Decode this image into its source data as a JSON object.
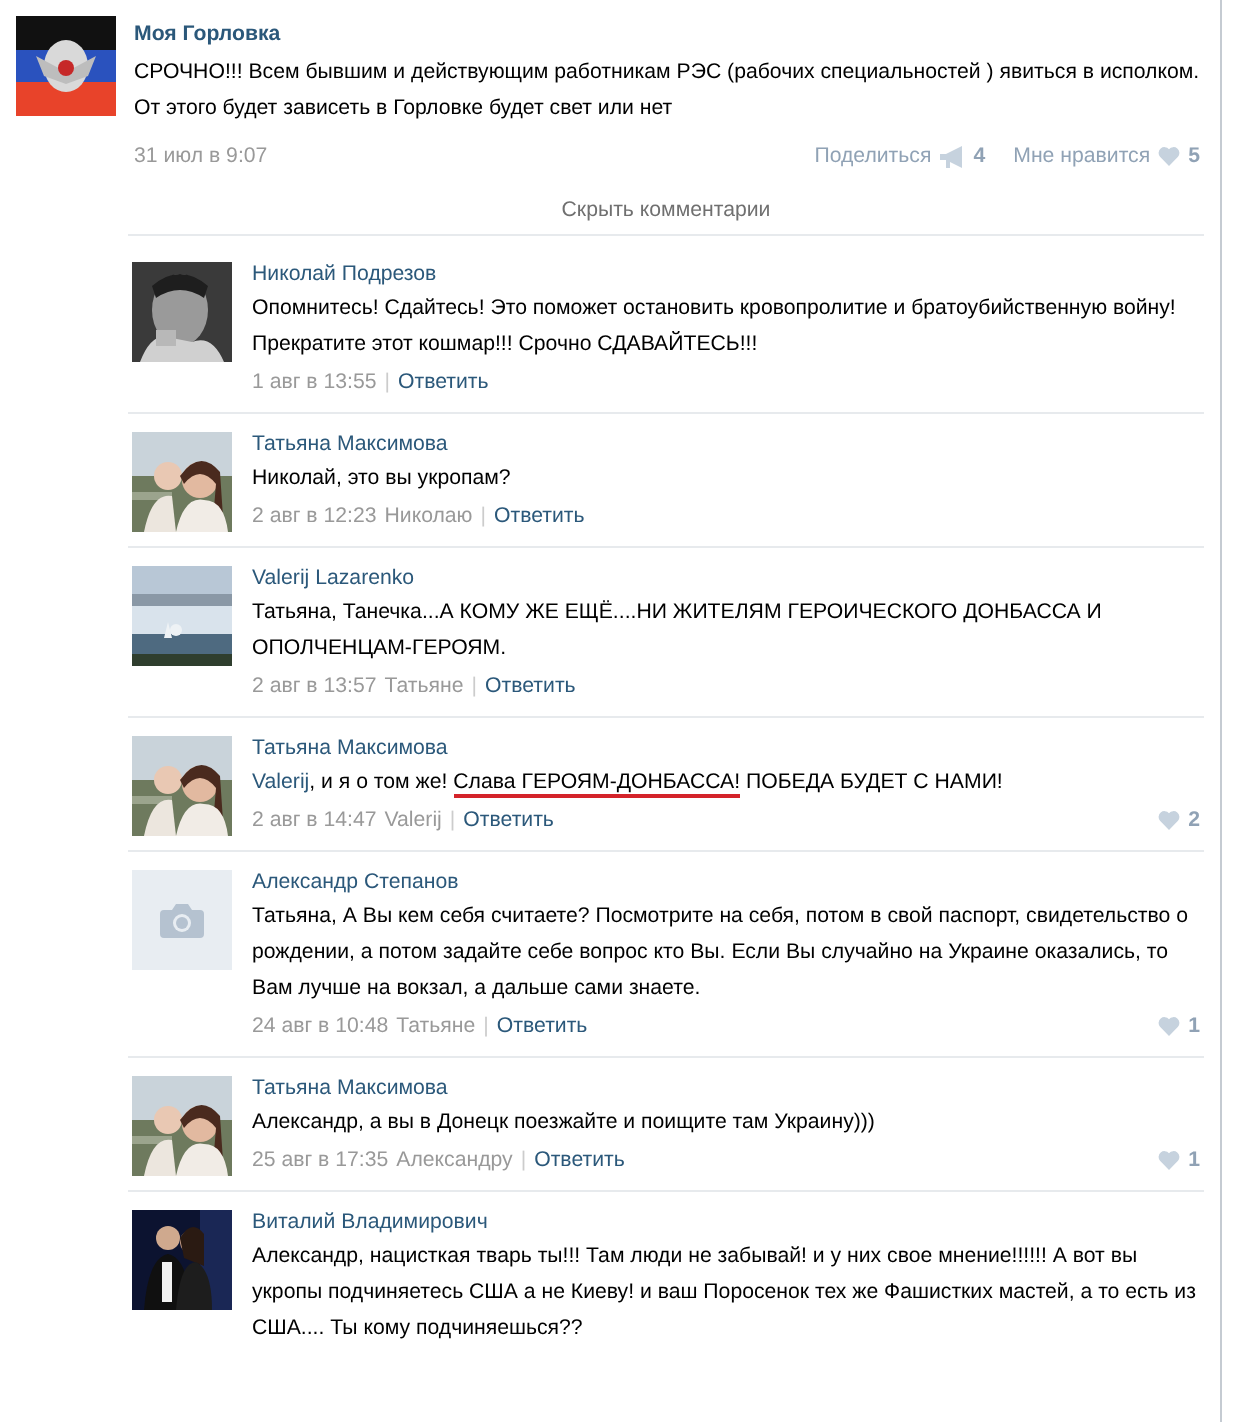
{
  "post": {
    "author": "Моя Горловка",
    "text": "СРОЧНО!!! Всем бывшим и действующим работникам РЭС (рабочих специальностей ) явиться в исполком. От этого будет зависеть в Горловке будет свет или нет",
    "date": "31 июл в 9:07",
    "share_label": "Поделиться",
    "share_count": "4",
    "like_label": "Мне нравится",
    "like_count": "5"
  },
  "hide_comments": "Скрыть комментарии",
  "comments": [
    {
      "author": "Николай Подрезов",
      "segments": [
        {
          "kind": "text",
          "text": "Опомнитесь! Сдайтесь! Это поможет остановить кровопролитие и братоубийственную войну! Прекратите этот кошмар!!! Срочно СДАВАЙТЕСЬ!!!"
        }
      ],
      "date": "1 авг в 13:55",
      "separator": "|",
      "reply": "Ответить"
    },
    {
      "author": "Татьяна Максимова",
      "segments": [
        {
          "kind": "text",
          "text": "Николай, это вы укропам?"
        }
      ],
      "date": "2 авг в 12:23",
      "reply_to": "Николаю",
      "separator": "|",
      "reply": "Ответить"
    },
    {
      "author": "Valerij Lazarenko",
      "segments": [
        {
          "kind": "text",
          "text": "Татьяна, Танечка...А КОМУ ЖЕ ЕЩЁ....НИ ЖИТЕЛЯМ ГЕРОИЧЕСКОГО ДОНБАССА И ОПОЛЧЕНЦАМ-ГЕРОЯМ."
        }
      ],
      "date": "2 авг в 13:57",
      "reply_to": "Татьяне",
      "separator": "|",
      "reply": "Ответить"
    },
    {
      "author": "Татьяна Максимова",
      "segments": [
        {
          "kind": "mention",
          "text": "Valerij"
        },
        {
          "kind": "text",
          "text": ", и я о том же! "
        },
        {
          "kind": "underlined",
          "text": "Слава ГЕРОЯМ-ДОНБАССА!"
        },
        {
          "kind": "text",
          "text": " ПОБЕДА БУДЕТ С НАМИ!"
        }
      ],
      "date": "2 авг в 14:47",
      "reply_to": "Valerij",
      "separator": "|",
      "reply": "Ответить",
      "likes": "2"
    },
    {
      "author": "Александр Степанов",
      "avatar": {
        "kind": "placeholder"
      },
      "segments": [
        {
          "kind": "text",
          "text": "Татьяна, А Вы кем себя считаете? Посмотрите на себя, потом в свой паспорт, свидетельство о рождении, а потом задайте себе вопрос кто Вы. Если Вы случайно на Украине оказались, то Вам лучше на вокзал, а дальше сами знаете."
        }
      ],
      "date": "24 авг в 10:48",
      "reply_to": "Татьяне",
      "separator": "|",
      "reply": "Ответить",
      "likes": "1"
    },
    {
      "author": "Татьяна Максимова",
      "segments": [
        {
          "kind": "text",
          "text": "Александр, а вы в Донецк поезжайте и поищите там Украину)))"
        }
      ],
      "date": "25 авг в 17:35",
      "reply_to": "Александру",
      "separator": "|",
      "reply": "Ответить",
      "likes": "1"
    },
    {
      "author": "Виталий Владимирович",
      "segments": [
        {
          "kind": "text",
          "text": "Александр, нацисткая тварь ты!!! Там люди не забывай! и у них свое мнение!!!!!! А вот вы укропы подчиняетесь США а не Киеву! и ваш Поросенок тех же Фашистких мастей, а то есть из США.... Ты кому подчиняешься??"
        }
      ]
    }
  ]
}
